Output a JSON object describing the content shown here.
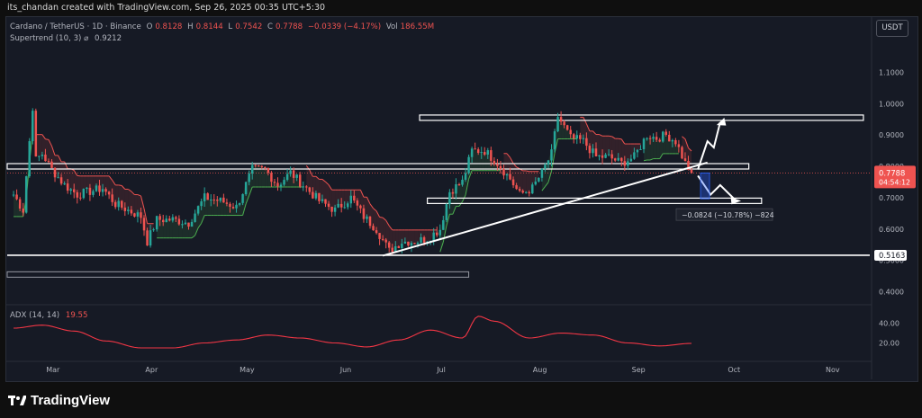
{
  "credit": "its_chandan created with TradingView.com, Sep 26, 2025 00:35 UTC+5:30",
  "header": {
    "symbol": "Cardano / TetherUS · 1D · Binance",
    "o_label": "O",
    "o": "0.8128",
    "h_label": "H",
    "h": "0.8144",
    "l_label": "L",
    "l": "0.7542",
    "c_label": "C",
    "c": "0.7788",
    "change": "−0.0339 (−4.17%)",
    "vol_label": "Vol",
    "vol": "186.55M"
  },
  "supertrend": {
    "label": "Supertrend (10, 3)",
    "marker": "⌀",
    "value": "0.9212"
  },
  "adx": {
    "label": "ADX (14, 14)",
    "value": "19.55"
  },
  "currency_button": "USDT",
  "price_tag": {
    "price": "0.7788",
    "countdown": "04:54:12"
  },
  "level_tag": "0.5163",
  "measure_label": "−0.0824 (−10.78%) −824",
  "logo_text": "TradingView",
  "colors": {
    "up": "#26a69a",
    "down": "#ef5350",
    "pane": "#161a25",
    "adx": "#f23645",
    "st_up": "#4caf50"
  },
  "chart_data": [
    {
      "type": "candlestick",
      "title": "Cardano / TetherUS · 1D · Binance",
      "x_ticks": [
        "Mar",
        "Apr",
        "May",
        "Jun",
        "Jul",
        "Aug",
        "Sep",
        "Oct",
        "Nov"
      ],
      "y_ticks": [
        "1.1000",
        "1.0000",
        "0.9000",
        "0.8000",
        "0.7000",
        "0.6000",
        "0.5000",
        "0.4000"
      ],
      "y_range": [
        0.37,
        1.21
      ],
      "x_range": [
        "2025-02-22",
        "2025-11-20"
      ],
      "series": [
        {
          "name": "price",
          "close": [
            [
              "2025-02-24",
              0.71
            ],
            [
              "2025-02-27",
              0.66
            ],
            [
              "2025-03-02",
              0.99
            ],
            [
              "2025-03-03",
              0.82
            ],
            [
              "2025-03-05",
              0.84
            ],
            [
              "2025-03-08",
              0.79
            ],
            [
              "2025-03-12",
              0.74
            ],
            [
              "2025-03-16",
              0.71
            ],
            [
              "2025-03-20",
              0.72
            ],
            [
              "2025-03-24",
              0.73
            ],
            [
              "2025-03-28",
              0.68
            ],
            [
              "2025-04-01",
              0.66
            ],
            [
              "2025-04-05",
              0.64
            ],
            [
              "2025-04-07",
              0.56
            ],
            [
              "2025-04-10",
              0.63
            ],
            [
              "2025-04-15",
              0.63
            ],
            [
              "2025-04-20",
              0.62
            ],
            [
              "2025-04-25",
              0.7
            ],
            [
              "2025-04-30",
              0.69
            ],
            [
              "2025-05-05",
              0.67
            ],
            [
              "2025-05-10",
              0.79
            ],
            [
              "2025-05-14",
              0.79
            ],
            [
              "2025-05-18",
              0.74
            ],
            [
              "2025-05-22",
              0.78
            ],
            [
              "2025-05-26",
              0.74
            ],
            [
              "2025-05-31",
              0.69
            ],
            [
              "2025-06-05",
              0.66
            ],
            [
              "2025-06-10",
              0.7
            ],
            [
              "2025-06-14",
              0.64
            ],
            [
              "2025-06-18",
              0.6
            ],
            [
              "2025-06-22",
              0.53
            ],
            [
              "2025-06-26",
              0.56
            ],
            [
              "2025-06-30",
              0.56
            ],
            [
              "2025-07-04",
              0.57
            ],
            [
              "2025-07-08",
              0.6
            ],
            [
              "2025-07-11",
              0.72
            ],
            [
              "2025-07-15",
              0.75
            ],
            [
              "2025-07-18",
              0.85
            ],
            [
              "2025-07-22",
              0.85
            ],
            [
              "2025-07-26",
              0.81
            ],
            [
              "2025-07-30",
              0.76
            ],
            [
              "2025-08-02",
              0.71
            ],
            [
              "2025-08-06",
              0.73
            ],
            [
              "2025-08-09",
              0.78
            ],
            [
              "2025-08-12",
              0.84
            ],
            [
              "2025-08-14",
              0.96
            ],
            [
              "2025-08-18",
              0.89
            ],
            [
              "2025-08-22",
              0.88
            ],
            [
              "2025-08-26",
              0.83
            ],
            [
              "2025-08-30",
              0.83
            ],
            [
              "2025-09-03",
              0.81
            ],
            [
              "2025-09-07",
              0.83
            ],
            [
              "2025-09-11",
              0.9
            ],
            [
              "2025-09-14",
              0.89
            ],
            [
              "2025-09-17",
              0.9
            ],
            [
              "2025-09-20",
              0.88
            ],
            [
              "2025-09-23",
              0.81
            ],
            [
              "2025-09-25",
              0.7788
            ]
          ]
        },
        {
          "name": "Supertrend (10, 3)",
          "current": 0.9212
        }
      ],
      "horizontal_levels": [
        0.955,
        0.8,
        0.69,
        0.5163,
        0.455
      ],
      "trendline": [
        [
          "2025-06-20",
          0.515
        ],
        [
          "2025-09-30",
          0.812
        ]
      ],
      "annotations": [
        "−0.0824 (−10.78%) −824"
      ]
    },
    {
      "type": "line",
      "title": "ADX (14, 14)",
      "y_ticks": [
        "40.00",
        "20.00"
      ],
      "series": [
        {
          "name": "ADX (14, 14)",
          "values": [
            [
              "2025-02-24",
              35
            ],
            [
              "2025-03-05",
              38
            ],
            [
              "2025-03-15",
              32
            ],
            [
              "2025-03-25",
              22
            ],
            [
              "2025-04-05",
              15
            ],
            [
              "2025-04-15",
              15
            ],
            [
              "2025-04-25",
              20
            ],
            [
              "2025-05-05",
              23
            ],
            [
              "2025-05-15",
              28
            ],
            [
              "2025-05-25",
              25
            ],
            [
              "2025-06-05",
              20
            ],
            [
              "2025-06-15",
              16
            ],
            [
              "2025-06-25",
              23
            ],
            [
              "2025-07-05",
              33
            ],
            [
              "2025-07-15",
              25
            ],
            [
              "2025-07-20",
              47
            ],
            [
              "2025-07-25",
              42
            ],
            [
              "2025-08-05",
              25
            ],
            [
              "2025-08-15",
              30
            ],
            [
              "2025-08-25",
              28
            ],
            [
              "2025-09-05",
              20
            ],
            [
              "2025-09-15",
              17
            ],
            [
              "2025-09-25",
              19.55
            ]
          ]
        }
      ]
    }
  ]
}
